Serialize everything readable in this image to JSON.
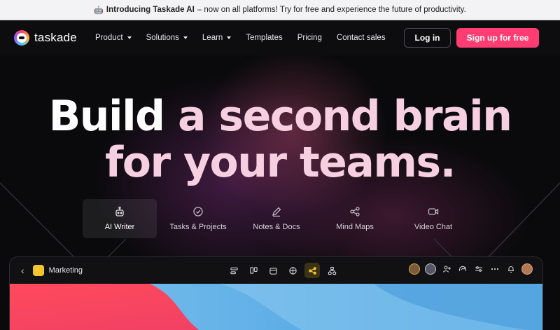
{
  "banner": {
    "emoji": "🤖",
    "headline": "Introducing Taskade AI",
    "text": "– now on all platforms! Try for free and experience the future of productivity."
  },
  "nav": {
    "logo_text": "taskade",
    "menu": [
      {
        "label": "Product",
        "dropdown": true
      },
      {
        "label": "Solutions",
        "dropdown": true
      },
      {
        "label": "Learn",
        "dropdown": true
      },
      {
        "label": "Templates",
        "dropdown": false
      },
      {
        "label": "Pricing",
        "dropdown": false
      },
      {
        "label": "Contact sales",
        "dropdown": false
      }
    ],
    "login_label": "Log in",
    "signup_label": "Sign up for free"
  },
  "hero": {
    "line1_a": "Build",
    "line1_b": "a second brain",
    "line2": "for your teams."
  },
  "feature_tabs": [
    {
      "label": "AI Writer",
      "icon": "robot-icon",
      "active": true
    },
    {
      "label": "Tasks & Projects",
      "icon": "check-circle-icon",
      "active": false
    },
    {
      "label": "Notes & Docs",
      "icon": "pen-icon",
      "active": false
    },
    {
      "label": "Mind Maps",
      "icon": "share-nodes-icon",
      "active": false
    },
    {
      "label": "Video Chat",
      "icon": "video-camera-icon",
      "active": false
    }
  ],
  "app_preview": {
    "workspace_name": "Marketing",
    "workspace_icon": "lightning-icon",
    "view_icons": [
      "list-view-icon",
      "board-view-icon",
      "calendar-view-icon",
      "table-view-icon",
      "mindmap-view-icon",
      "org-chart-view-icon"
    ],
    "active_view": "mindmap-view-icon",
    "toolbar_icons": [
      "add-user-icon",
      "automation-icon",
      "settings-icon",
      "more-icon",
      "bell-icon"
    ]
  },
  "colors": {
    "accent": "#ff3d72",
    "banner_bg": "#f3f3f5",
    "page_bg": "#0a0a0c",
    "workspace_icon": "#f4c430"
  }
}
